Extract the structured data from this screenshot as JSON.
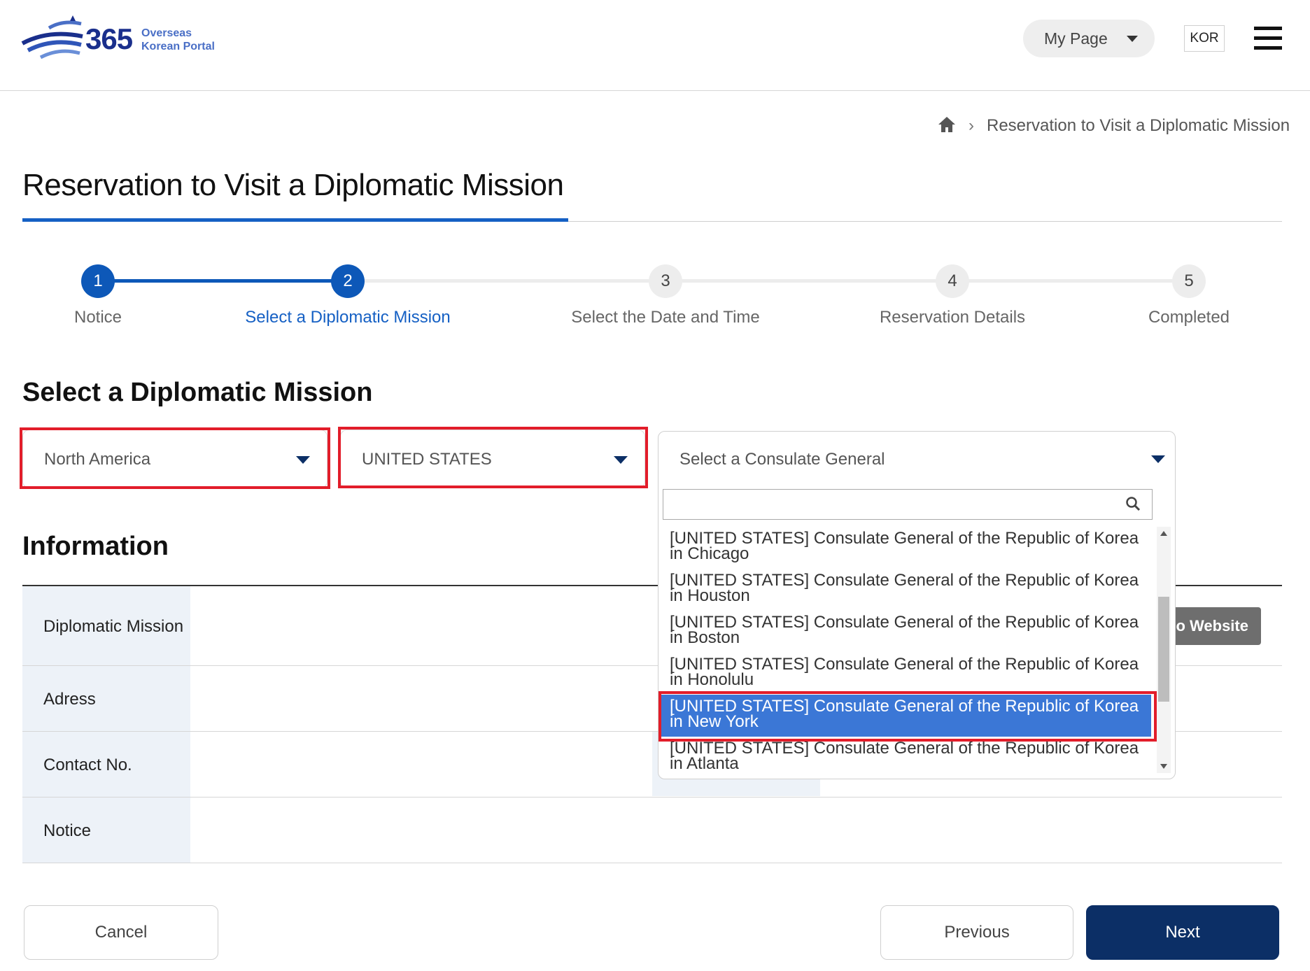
{
  "header": {
    "logo_number": "365",
    "logo_line1": "Overseas",
    "logo_line2": "Korean Portal",
    "mypage_label": "My Page",
    "lang_label": "KOR"
  },
  "breadcrumb": {
    "current": "Reservation to Visit a Diplomatic Mission"
  },
  "page_title": "Reservation to Visit a Diplomatic Mission",
  "steps": [
    {
      "number": "1",
      "label": "Notice",
      "state": "done"
    },
    {
      "number": "2",
      "label": "Select a Diplomatic Mission",
      "state": "current"
    },
    {
      "number": "3",
      "label": "Select the Date and Time",
      "state": "todo"
    },
    {
      "number": "4",
      "label": "Reservation Details",
      "state": "todo"
    },
    {
      "number": "5",
      "label": "Completed",
      "state": "todo"
    }
  ],
  "select_section": {
    "title": "Select a Diplomatic Mission",
    "region_value": "North America",
    "country_value": "UNITED STATES",
    "consulate_placeholder": "Select a Consulate General"
  },
  "dropdown": {
    "search_value": "",
    "options": [
      "[UNITED STATES] Consulate General of the Republic of Korea in Chicago",
      "[UNITED STATES] Consulate General of the Republic of Korea in Houston",
      "[UNITED STATES] Consulate General of the Republic of Korea in Boston",
      "[UNITED STATES] Consulate General of the Republic of Korea in Honolulu",
      "[UNITED STATES] Consulate General of the Republic of Korea in New York",
      "[UNITED STATES] Consulate General of the Republic of Korea in Atlanta"
    ],
    "selected_index": 4
  },
  "info_section": {
    "title": "Information",
    "rows": [
      "Diplomatic Mission",
      "Adress",
      "Contact No.",
      "Notice"
    ],
    "website_button": "o Website"
  },
  "buttons": {
    "cancel": "Cancel",
    "previous": "Previous",
    "next": "Next"
  },
  "colors": {
    "accent_blue": "#1560c4",
    "navy": "#0c2f66",
    "highlight_red": "#e21d2a",
    "selected_option": "#3b77d6"
  }
}
